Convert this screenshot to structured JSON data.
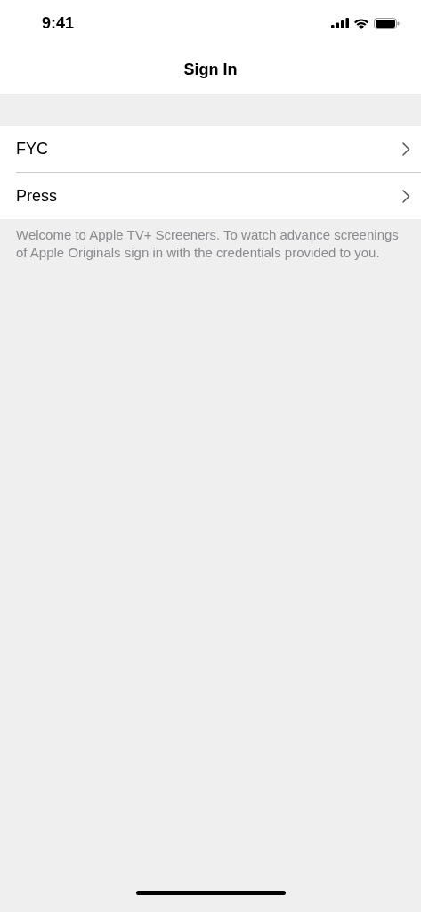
{
  "status_bar": {
    "time": "9:41"
  },
  "nav_bar": {
    "title": "Sign In"
  },
  "list": {
    "items": [
      {
        "label": "FYC"
      },
      {
        "label": "Press"
      }
    ]
  },
  "footer": "Welcome to Apple TV+ Screeners. To watch advance screenings of Apple Originals sign in with the credentials provided to you."
}
